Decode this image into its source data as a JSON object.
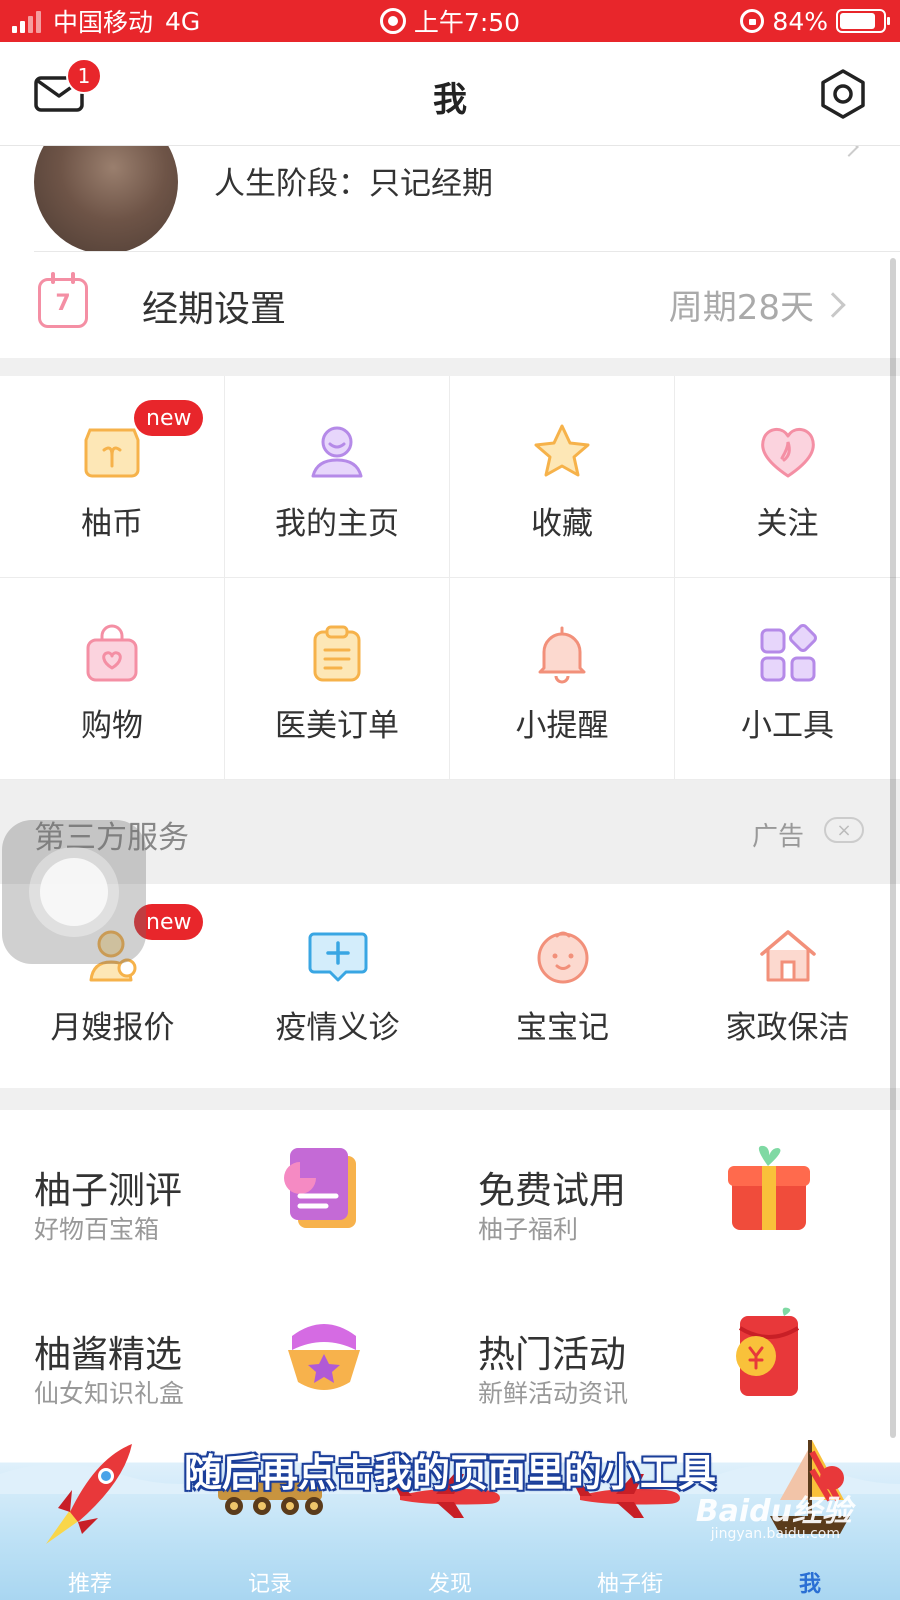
{
  "status_bar": {
    "carrier": "中国移动",
    "network": "4G",
    "time": "上午7:50",
    "battery": "84%",
    "battery_level": 0.84
  },
  "header": {
    "title": "我",
    "mail_badge": "1"
  },
  "profile": {
    "stage": "人生阶段：只记经期"
  },
  "period_settings": {
    "label": "经期设置",
    "value": "周期28天",
    "calendar_day": "7"
  },
  "grid": [
    {
      "label": "柚币",
      "icon": "coin-bag-icon",
      "badge": "new"
    },
    {
      "label": "我的主页",
      "icon": "user-profile-icon"
    },
    {
      "label": "收藏",
      "icon": "star-icon"
    },
    {
      "label": "关注",
      "icon": "heart-icon"
    },
    {
      "label": "购物",
      "icon": "shopping-bag-icon"
    },
    {
      "label": "医美订单",
      "icon": "clipboard-icon"
    },
    {
      "label": "小提醒",
      "icon": "bell-icon"
    },
    {
      "label": "小工具",
      "icon": "tools-grid-icon"
    }
  ],
  "third_party": {
    "title": "第三方服务",
    "ad_label": "广告",
    "close": "×",
    "items": [
      {
        "label": "月嫂报价",
        "icon": "nanny-icon",
        "badge": "new"
      },
      {
        "label": "疫情义诊",
        "icon": "medical-chat-icon"
      },
      {
        "label": "宝宝记",
        "icon": "baby-face-icon"
      },
      {
        "label": "家政保洁",
        "icon": "house-icon"
      }
    ]
  },
  "features": [
    {
      "title": "柚子测评",
      "subtitle": "好物百宝箱",
      "icon": "review-card-icon"
    },
    {
      "title": "免费试用",
      "subtitle": "柚子福利",
      "icon": "gift-box-icon"
    },
    {
      "title": "柚酱精选",
      "subtitle": "仙女知识礼盒",
      "icon": "gem-box-icon"
    },
    {
      "title": "热门活动",
      "subtitle": "新鲜活动资讯",
      "icon": "red-envelope-icon"
    }
  ],
  "tabbar": [
    {
      "label": "推荐",
      "icon": "rocket-icon"
    },
    {
      "label": "记录",
      "icon": "train-icon"
    },
    {
      "label": "发现",
      "icon": "airplane-icon"
    },
    {
      "label": "柚子街",
      "icon": "airplane-icon"
    },
    {
      "label": "我",
      "icon": "sailboat-icon",
      "active": true
    }
  ],
  "overlay": {
    "caption": "随后再点击我的页面里的小工具",
    "watermark": "Baidu经验",
    "watermark_sub": "jingyan.baidu.com"
  },
  "colors": {
    "brand_red": "#e8262b",
    "icon_pink": "#f48fa4",
    "icon_purple": "#b58ae8",
    "icon_orange": "#f6b24a",
    "icon_blue": "#39a6e3"
  }
}
